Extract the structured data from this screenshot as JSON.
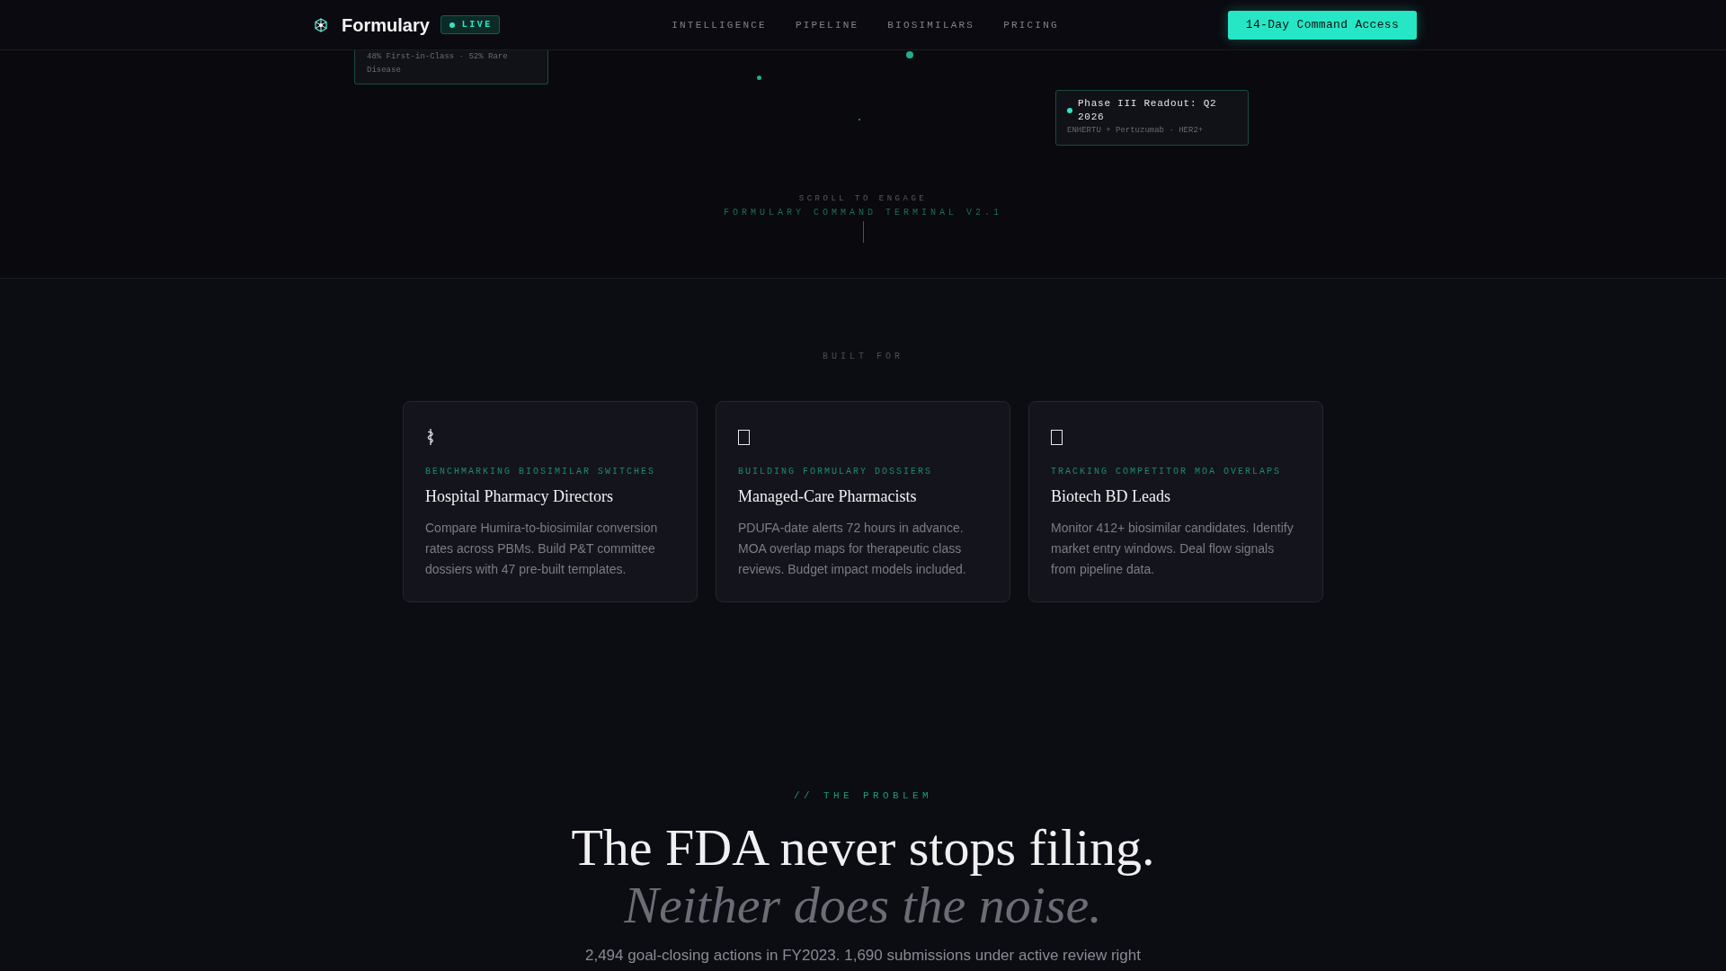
{
  "header": {
    "brand": "Formulary",
    "badge": "LIVE",
    "nav": [
      "INTELLIGENCE",
      "PIPELINE",
      "BIOSIMILARS",
      "PRICING"
    ],
    "cta": "14-Day Command Access"
  },
  "hero": {
    "signal_cards": [
      {
        "detail": "48% First-in-Class · 52% Rare Disease"
      },
      {
        "title": "Phase III Readout: Q2 2026",
        "detail": "ENHERTU + Pertuzumab · HER2+"
      }
    ],
    "scroll_hint": "SCROLL TO ENGAGE",
    "terminal_label": "FORMULARY COMMAND TERMINAL V2.1"
  },
  "audience": {
    "label": "BUILT FOR",
    "cards": [
      {
        "tag": "BENCHMARKING BIOSIMILAR SWITCHES",
        "title": "Hospital Pharmacy Directors",
        "description": "Compare Humira-to-biosimilar conversion rates across PBMs. Build P&T committee dossiers with 47 pre-built templates."
      },
      {
        "tag": "BUILDING FORMULARY DOSSIERS",
        "title": "Managed-Care Pharmacists",
        "description": "PDUFA-date alerts 72 hours in advance. MOA overlap maps for therapeutic class reviews. Budget impact models included."
      },
      {
        "tag": "TRACKING COMPETITOR MOA OVERLAPS",
        "title": "Biotech BD Leads",
        "description": "Monitor 412+ biosimilar candidates. Identify market entry windows. Deal flow signals from pipeline data."
      }
    ]
  },
  "problem": {
    "eyebrow": "// THE PROBLEM",
    "heading": "The FDA never stops filing.",
    "subheading": "Neither does the noise.",
    "body": "2,494 goal-closing actions in FY2023. 1,690 submissions under active review right"
  }
}
